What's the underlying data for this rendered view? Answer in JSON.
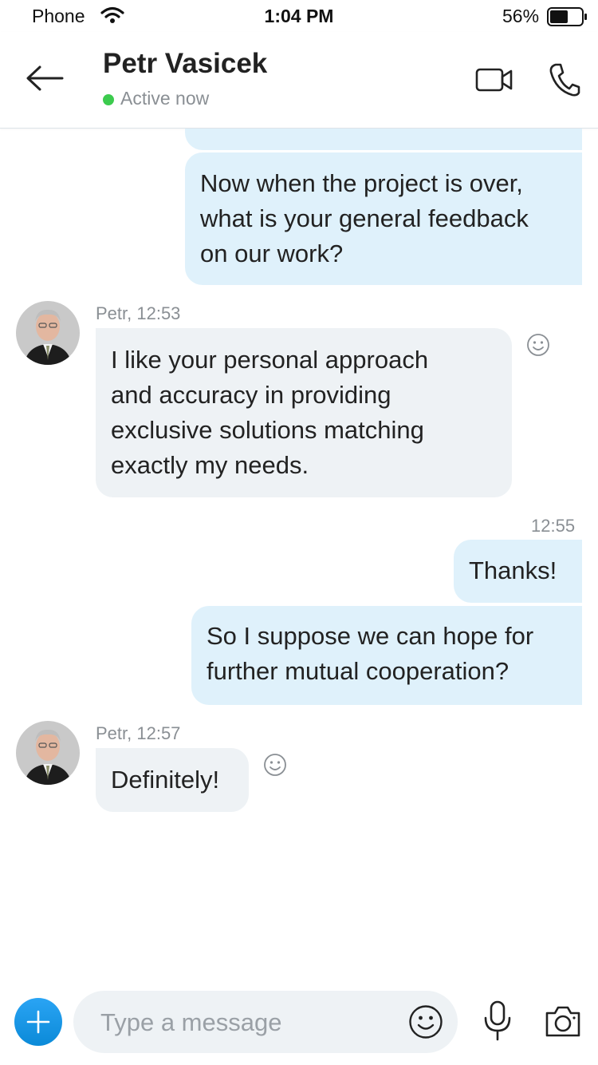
{
  "status_bar": {
    "carrier": "Phone",
    "time": "1:04 PM",
    "battery": "56%"
  },
  "header": {
    "contact_name": "Petr Vasicek",
    "presence": "Active now",
    "presence_color": "#3ccb4e"
  },
  "messages": [
    {
      "id": "out-1",
      "direction": "outgoing",
      "text_lines": [
        "Now when the project is over,",
        "what is your general feedback",
        "on our work?"
      ]
    },
    {
      "id": "in-1",
      "direction": "incoming",
      "meta": "Petr, 12:53",
      "text_lines": [
        "I like your personal approach",
        "and accuracy in providing",
        "exclusive solutions matching",
        "exactly my needs."
      ]
    },
    {
      "id": "out-2",
      "direction": "outgoing",
      "meta": "12:55",
      "text_lines": [
        "Thanks!"
      ]
    },
    {
      "id": "out-3",
      "direction": "outgoing",
      "text_lines": [
        "So I suppose we can hope for",
        "further mutual cooperation?"
      ]
    },
    {
      "id": "in-2",
      "direction": "incoming",
      "meta": "Petr, 12:57",
      "text_lines": [
        "Definitely!"
      ]
    }
  ],
  "composer": {
    "placeholder": "Type a message"
  },
  "colors": {
    "accent": "#0b8ad8",
    "outgoing_bubble": "#dff1fb",
    "incoming_bubble": "#eef2f5"
  }
}
